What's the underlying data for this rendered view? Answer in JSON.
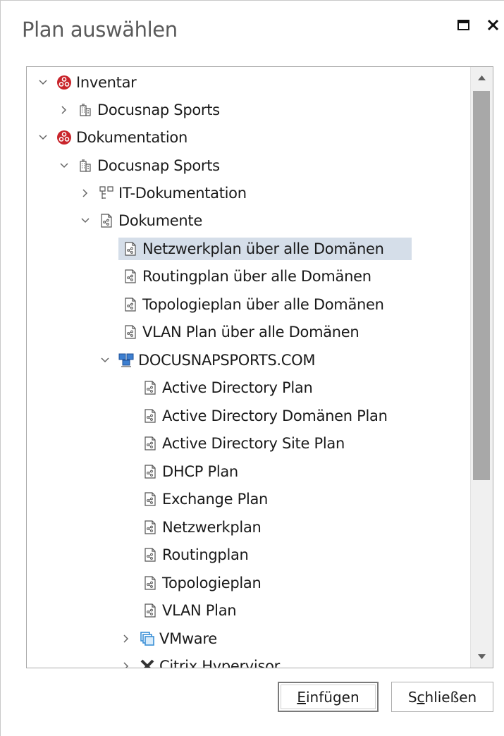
{
  "dialog": {
    "title": "Plan auswählen",
    "maximize_icon": "maximize-icon",
    "close_icon": "close-icon"
  },
  "tree": {
    "selected_color": "#d5dee9",
    "items": [
      {
        "label": "Inventar",
        "icon": "docusnap-logo-icon",
        "expanded": true
      },
      {
        "label": "Docusnap Sports",
        "icon": "building-icon",
        "expanded": false
      },
      {
        "label": "Dokumentation",
        "icon": "docusnap-logo-icon",
        "expanded": true
      },
      {
        "label": "Docusnap Sports",
        "icon": "building-icon",
        "expanded": true
      },
      {
        "label": "IT-Dokumentation",
        "icon": "hierarchy-icon",
        "expanded": false
      },
      {
        "label": "Dokumente",
        "icon": "plan-document-icon",
        "expanded": true
      },
      {
        "label": "Netzwerkplan über alle Domänen",
        "icon": "plan-document-icon",
        "selected": true
      },
      {
        "label": "Routingplan über alle Domänen",
        "icon": "plan-document-icon"
      },
      {
        "label": "Topologieplan über alle Domänen",
        "icon": "plan-document-icon"
      },
      {
        "label": "VLAN Plan über alle Domänen",
        "icon": "plan-document-icon"
      },
      {
        "label": "DOCUSNAPSPORTS.COM",
        "icon": "domain-icon",
        "expanded": true
      },
      {
        "label": "Active Directory Plan",
        "icon": "plan-document-icon"
      },
      {
        "label": "Active Directory Domänen Plan",
        "icon": "plan-document-icon"
      },
      {
        "label": "Active Directory Site Plan",
        "icon": "plan-document-icon"
      },
      {
        "label": "DHCP Plan",
        "icon": "plan-document-icon"
      },
      {
        "label": "Exchange Plan",
        "icon": "plan-document-icon"
      },
      {
        "label": "Netzwerkplan",
        "icon": "plan-document-icon"
      },
      {
        "label": "Routingplan",
        "icon": "plan-document-icon"
      },
      {
        "label": "Topologieplan",
        "icon": "plan-document-icon"
      },
      {
        "label": "VLAN Plan",
        "icon": "plan-document-icon"
      },
      {
        "label": "VMware",
        "icon": "vmware-icon",
        "expanded": false
      },
      {
        "label": "Citrix Hypervisor",
        "icon": "citrix-icon",
        "expanded": false
      }
    ]
  },
  "buttons": {
    "insert": {
      "accel": "E",
      "rest": "infügen"
    },
    "close": {
      "pre": "S",
      "accel": "c",
      "rest": "hließen"
    }
  }
}
